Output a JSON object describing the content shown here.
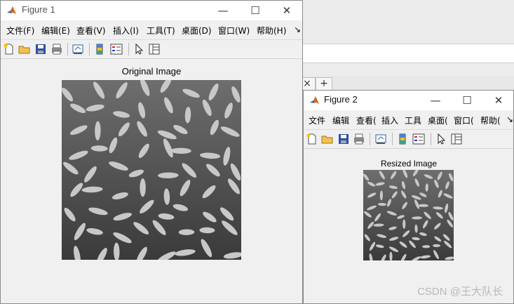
{
  "figure1": {
    "title": "Figure 1",
    "menu": [
      "文件(F)",
      "编辑(E)",
      "查看(V)",
      "插入(I)",
      "工具(T)",
      "桌面(D)",
      "窗口(W)",
      "帮助(H)"
    ],
    "menu_more": "↘",
    "axes_title": "Original Image"
  },
  "figure2": {
    "title": "Figure 2",
    "menu": [
      "文件",
      "编辑",
      "查看(",
      "插入",
      "工具",
      "桌面(",
      "窗口(",
      "帮助("
    ],
    "menu_more": "↘",
    "axes_title": "Resized Image"
  },
  "window_controls": {
    "minimize": "—",
    "maximize": "☐",
    "close": "✕"
  },
  "background_app": {
    "tab_close": "×",
    "tab_add": "+"
  },
  "toolbar_icons": [
    "new-figure-icon",
    "open-file-icon",
    "save-icon",
    "print-icon",
    "link-plot-icon",
    "colorbar-icon",
    "legend-icon",
    "pointer-icon",
    "property-inspector-icon"
  ],
  "watermark": "CSDN @王大队长",
  "colors": {
    "grain": "#c8c8c8",
    "background_dark": "#4a4a4a",
    "window_bg": "#f0f0f0"
  }
}
